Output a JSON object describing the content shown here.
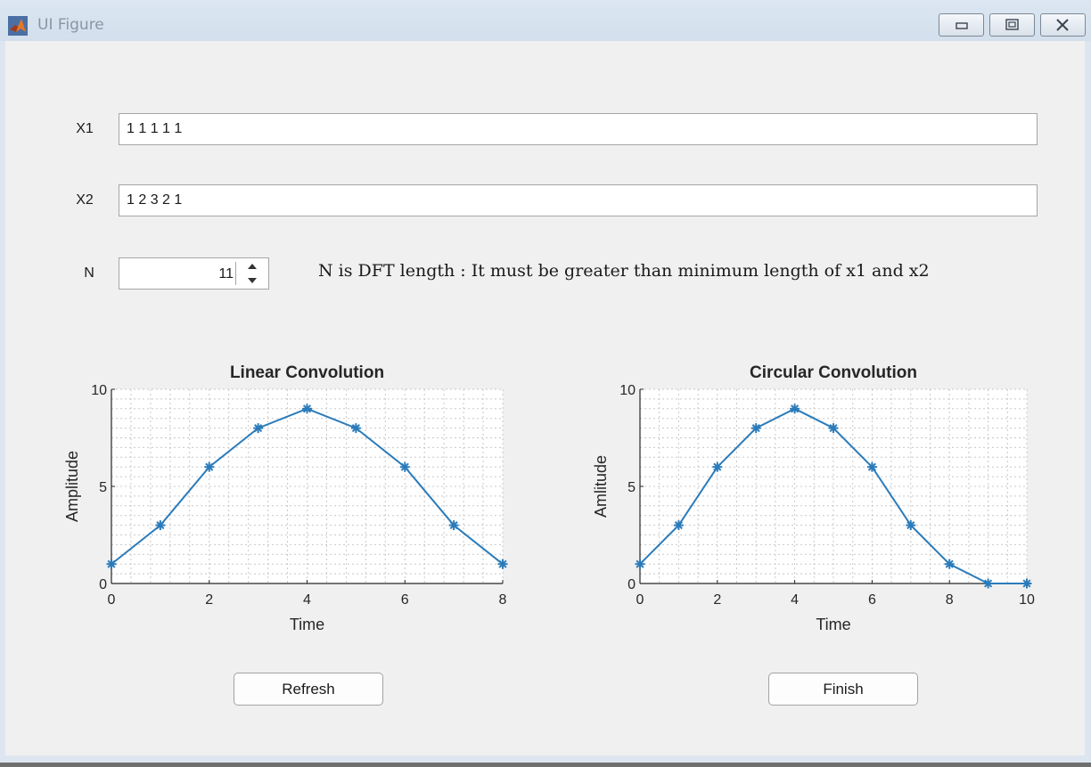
{
  "window": {
    "title": "UI Figure",
    "icon": "matlab-icon",
    "controls": [
      "minimize-icon",
      "maximize-icon",
      "close-icon"
    ]
  },
  "inputs": {
    "x1": {
      "label": "X1",
      "value": "1 1 1 1 1"
    },
    "x2": {
      "label": "X2",
      "value": "1 2 3 2 1"
    },
    "n": {
      "label": "N",
      "value": "11"
    }
  },
  "note": "N is DFT length : It must be greater than minimum length of x1 and x2",
  "buttons": {
    "refresh": "Refresh",
    "finish": "Finish"
  },
  "colors": {
    "series": "#2b7bba",
    "grid": "#c8c8c8"
  },
  "chart_data": [
    {
      "type": "line",
      "title": "Linear Convolution",
      "xlabel": "Time",
      "ylabel": "Amplitude",
      "x": [
        0,
        1,
        2,
        3,
        4,
        5,
        6,
        7,
        8
      ],
      "series": [
        {
          "values": [
            1,
            3,
            6,
            8,
            9,
            8,
            6,
            3,
            1
          ]
        }
      ],
      "xlim": [
        0,
        8
      ],
      "ylim": [
        0,
        10
      ],
      "xticks": [
        0,
        2,
        4,
        6,
        8
      ],
      "yticks": [
        0,
        5,
        10
      ],
      "marker": "asterisk",
      "grid": true
    },
    {
      "type": "line",
      "title": "Circular Convolution",
      "xlabel": "Time",
      "ylabel": "Amlitude",
      "x": [
        0,
        1,
        2,
        3,
        4,
        5,
        6,
        7,
        8,
        9,
        10
      ],
      "series": [
        {
          "values": [
            1,
            3,
            6,
            8,
            9,
            8,
            6,
            3,
            1,
            0,
            0
          ]
        }
      ],
      "xlim": [
        0,
        10
      ],
      "ylim": [
        0,
        10
      ],
      "xticks": [
        0,
        2,
        4,
        6,
        8,
        10
      ],
      "yticks": [
        0,
        5,
        10
      ],
      "marker": "asterisk",
      "grid": true
    }
  ]
}
